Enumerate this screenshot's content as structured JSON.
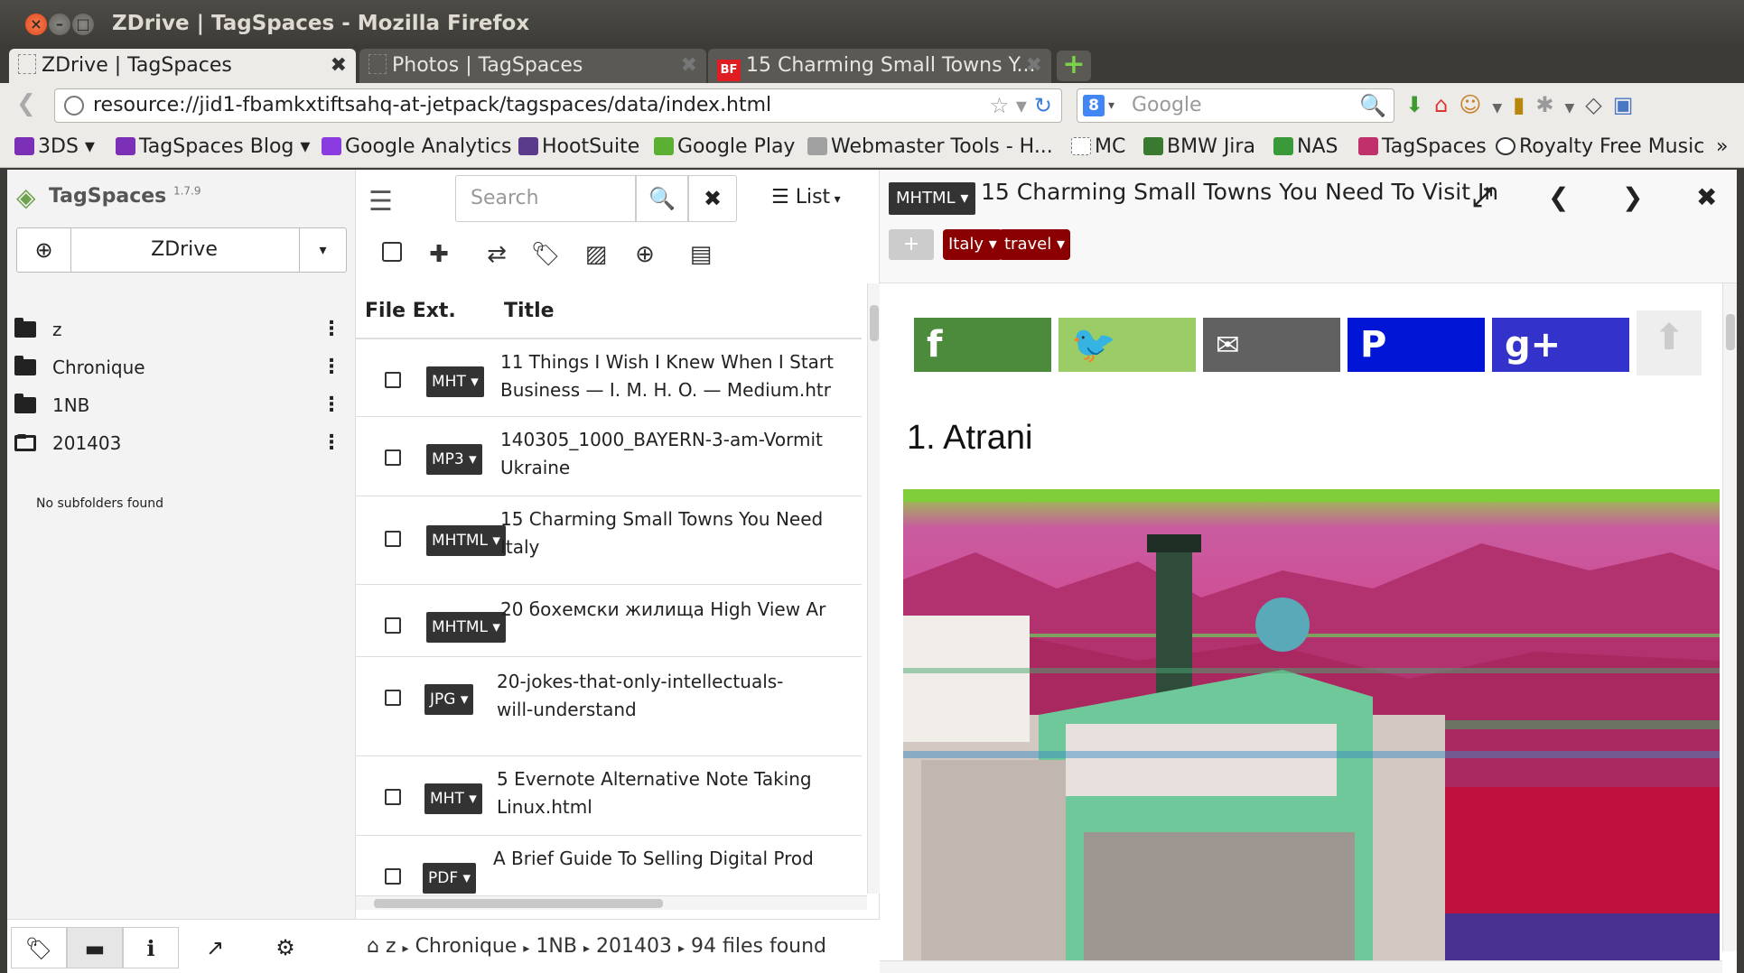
{
  "window": {
    "title": "ZDrive | TagSpaces - Mozilla Firefox",
    "buttons": {
      "close": "×",
      "minimize": "–",
      "maximize": "□"
    }
  },
  "tabs": [
    {
      "label": "ZDrive | TagSpaces",
      "active": true,
      "close": "✖"
    },
    {
      "label": "Photos | TagSpaces",
      "active": false,
      "close": "✖"
    },
    {
      "label": "15 Charming Small Towns Y...",
      "active": false,
      "close": "✖",
      "favicon": "BF"
    }
  ],
  "newtab_label": "+",
  "navbar": {
    "back": "❮",
    "url": "resource://jid1-fbamkxtiftsahq-at-jetpack/tagspaces/data/index.html",
    "url_icons": "☆ ▾",
    "reload": "↻",
    "search_placeholder": "Google",
    "search_engine": "8",
    "search_caret": "▾",
    "search_icon": "🔍"
  },
  "bookmarks": [
    {
      "label": "3DS ▾",
      "color": "#7b2fb7"
    },
    {
      "label": "TagSpaces Blog ▾",
      "color": "#7b2fb7"
    },
    {
      "label": "Google Analytics",
      "color": "#8a3ce0"
    },
    {
      "label": "HootSuite",
      "color": "#5a3a8a"
    },
    {
      "label": "Google Play",
      "color": "#5bb033"
    },
    {
      "label": "Webmaster Tools - H...",
      "color": "#a0a0a0"
    },
    {
      "label": "MC",
      "color": "#ffffff"
    },
    {
      "label": "BMW Jira",
      "color": "#3a7a30"
    },
    {
      "label": "NAS",
      "color": "#3a9a3a"
    },
    {
      "label": "TagSpaces",
      "color": "#c0306a"
    },
    {
      "label": "Royalty Free Music",
      "color": "#ffffff"
    }
  ],
  "bookmarks_more": "»",
  "app": {
    "name": "TagSpaces",
    "version": "1.7.9",
    "location": {
      "add": "⊕",
      "name": "ZDrive",
      "caret": "▾"
    },
    "folders": [
      {
        "name": "z",
        "open": false
      },
      {
        "name": "Chronique",
        "open": false
      },
      {
        "name": "1NB",
        "open": false
      },
      {
        "name": "201403",
        "open": true
      }
    ],
    "folder_menu": "⋮",
    "no_subfolders": "No subfolders found",
    "bottom_icons": [
      "tags-icon",
      "folder-icon",
      "info-icon",
      "open-external-icon",
      "settings-icon"
    ],
    "search_placeholder": "Search",
    "view_mode": "List",
    "columns": {
      "ext": "File Ext.",
      "title": "Title"
    },
    "files": [
      {
        "ext": "MHT",
        "title": "11 Things I Wish I Knew When I Start\nBusiness — I. M. H. O. — Medium.htr"
      },
      {
        "ext": "MP3",
        "title": "140305_1000_BAYERN-3-am-Vormit\nUkraine"
      },
      {
        "ext": "MHTML",
        "title": "15 Charming Small Towns You Need\nItaly"
      },
      {
        "ext": "MHTML",
        "title": "20 бохемски жилища High View Ar"
      },
      {
        "ext": "JPG",
        "title": "20-jokes-that-only-intellectuals-\nwill-understand"
      },
      {
        "ext": "MHT",
        "title": "5 Evernote Alternative Note Taking\nLinux.html"
      },
      {
        "ext": "PDF",
        "title": "A Brief Guide To Selling Digital Prod"
      }
    ],
    "breadcrumb": [
      "z",
      "Chronique",
      "1NB",
      "201403"
    ],
    "files_found": "94 files found"
  },
  "viewer": {
    "ext": "MHTML",
    "title": "15 Charming Small Towns You Need To Visit In",
    "tags": [
      "Italy",
      "travel"
    ],
    "add_tag": "+",
    "heading": "1. Atrani",
    "share": {
      "facebook": "f",
      "twitter": "🐦",
      "email": "✉",
      "pinterest": "P",
      "googleplus": "g+",
      "top": "⬆"
    }
  }
}
